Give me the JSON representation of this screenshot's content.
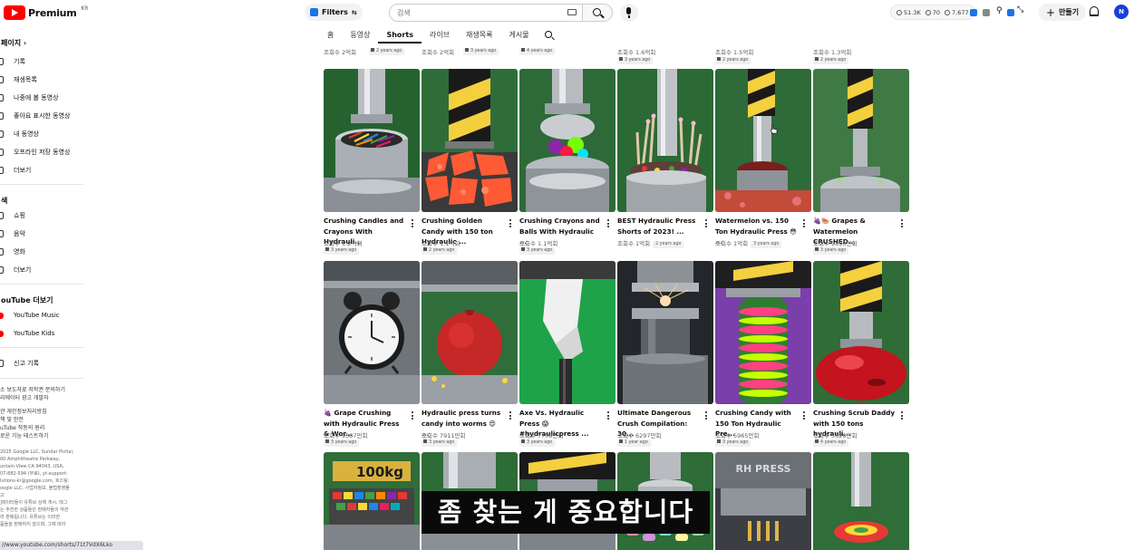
{
  "header": {
    "logo_text": "Premium",
    "logo_region": "KR",
    "filters_label": "Filters",
    "search_placeholder": "검색",
    "stats": [
      "51.3K",
      "70",
      "7,677"
    ],
    "create_label": "만들기",
    "avatar_initial": "N"
  },
  "tabs": [
    {
      "label": "홈"
    },
    {
      "label": "동영상"
    },
    {
      "label": "Shorts"
    },
    {
      "label": "라이브"
    },
    {
      "label": "재생목록"
    },
    {
      "label": "게시물"
    }
  ],
  "sidebar": {
    "you_heading": "페이지",
    "you_items": [
      "기록",
      "재생목록",
      "나중에 볼 동영상",
      "좋아요 표시한 동영상",
      "내 동영상",
      "오프라인 저장 동영상",
      "더보기"
    ],
    "explore_heading": "색",
    "explore_items": [
      "쇼핑",
      "음악",
      "영화",
      "더보기"
    ],
    "more_heading": "ouTube 더보기",
    "more_items": [
      "YouTube Music",
      "YouTube Kids"
    ],
    "report_item": "신고 기록",
    "footer_links_1": "소 보도자료 저작권 문의하기",
    "footer_links_2": "리에이터 광고 개발자",
    "footer_links_3": "관 개인정보처리방침",
    "footer_links_4": "책 및 안전",
    "footer_links_5": "uTube 작동의 원리",
    "footer_links_6": "로운 기능 테스트하기",
    "legal": [
      "2025 Google LLC, Sundar Pichai,",
      "00 Amphitheatre Parkway,",
      "untain View CA 94043, USA,",
      "07-882-594 (무료), yt-support-",
      "lutions-kr@google.com, 호스팅:",
      "oogle LLC, 사업자정보, 불법촬영물",
      "고",
      "]레이터들이 유튜브 상에 게시, 태그",
      "는 추천한 상품들은 판매자들의 약관",
      "라 판매됩니다. 유튜브는 이러한",
      "품들을 판매하지 않으며, 그에 따라"
    ],
    "legal_link_1": "사업자정보",
    "legal_link_2": "불법촬영물",
    "status_url": "//www.youtube.com/shorts/71t7VdX6Lko"
  },
  "top_partial_row": [
    {
      "views": "조회수 2억회",
      "age": "2 years ago"
    },
    {
      "views": "조회수 2억회",
      "age": "3 years ago"
    },
    {
      "views": "",
      "age": "4 years ago"
    },
    {
      "views": "조회수 1.6억회",
      "age": "3 years ago"
    },
    {
      "views": "조회수 1.5억회",
      "age": "2 years ago"
    },
    {
      "views": "조회수 1.3억회",
      "age": "2 years ago"
    }
  ],
  "videos_row1": [
    {
      "title": "Crushing Candles and Crayons With Hydrauli...",
      "views": "조회수 1.2억회",
      "age": "3 years ago"
    },
    {
      "title": "Crushing Golden Candy with 150 ton Hydraulic ...",
      "views": "조회수 1.1억회",
      "age": "2 years ago"
    },
    {
      "title": "Crushing Crayons and Balls With Hydraulic ...",
      "views": "조회수 1.1억회",
      "age": "3 years ago"
    },
    {
      "title": "BEST Hydraulic Press Shorts of 2023! ...",
      "views": "조회수 1억회",
      "age": "2 years ago"
    },
    {
      "title": "Watermelon vs. 150 Ton Hydraulic Press 😳 ...",
      "views": "조회수 1억회",
      "age": "3 years ago"
    },
    {
      "title": "🍇🍉 Grapes & Watermelon CRUSHED...",
      "views": "조회수 9896만회",
      "age": "3 years ago"
    }
  ],
  "videos_row2": [
    {
      "title": "🍇 Grape Crushing with Hydraulic Press & Wor...",
      "views": "조회수 9387만회",
      "age": "3 years ago"
    },
    {
      "title": "Hydraulic press turns candy into worms 😍 ...",
      "views": "조회수 7911만회",
      "age": "3 years ago"
    },
    {
      "title": "Axe Vs. Hydraulic Press 😱 #hydraulicpress ...",
      "views": "조회수 7708만회",
      "age": "3 years ago"
    },
    {
      "title": "Ultimate Dangerous Crush Compilation: 30...",
      "views": "조회수 6297만회",
      "age": "1 year ago"
    },
    {
      "title": "Crushing Candy with 150 Ton Hydraulic Pre...",
      "views": "조회수 5965만회",
      "age": "3 years ago"
    },
    {
      "title": "Crushing Scrub Daddy with 150 tons hydrauli...",
      "views": "조회수 5628만회",
      "age": "4 years ago"
    }
  ],
  "row3_thumb_texts": [
    "100kg",
    "RH PRESS"
  ],
  "caption_text": "좀 찾는 게 중요합니다",
  "colors": {
    "brand_red": "#ff0000",
    "avatar_blue": "#1a3fd8",
    "caption_bg": "#0a0a0a"
  }
}
